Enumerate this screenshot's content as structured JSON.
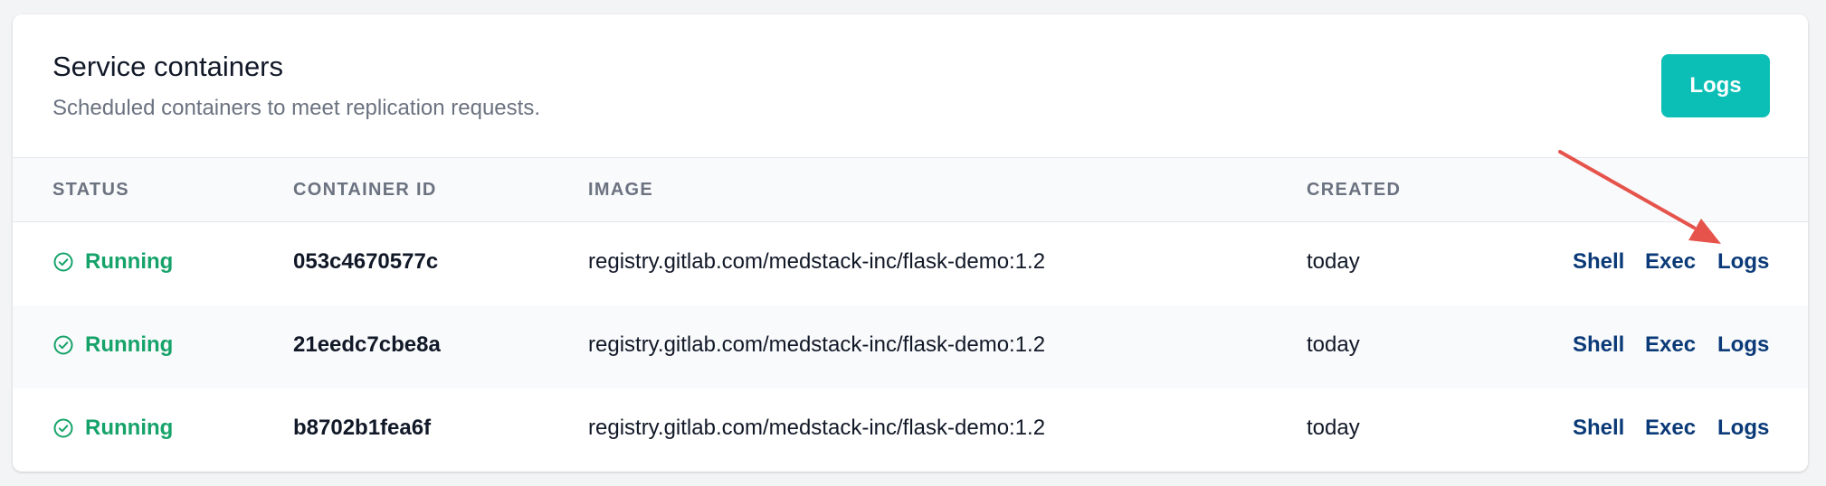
{
  "header": {
    "title": "Service containers",
    "subtitle": "Scheduled containers to meet replication requests.",
    "logs_button_label": "Logs"
  },
  "table": {
    "columns": {
      "status": "STATUS",
      "container_id": "CONTAINER ID",
      "image": "IMAGE",
      "created": "CREATED"
    },
    "rows": [
      {
        "status": "Running",
        "container_id": "053c4670577c",
        "image": "registry.gitlab.com/medstack-inc/flask-demo:1.2",
        "created": "today",
        "actions": {
          "shell": "Shell",
          "exec": "Exec",
          "logs": "Logs"
        }
      },
      {
        "status": "Running",
        "container_id": "21eedc7cbe8a",
        "image": "registry.gitlab.com/medstack-inc/flask-demo:1.2",
        "created": "today",
        "actions": {
          "shell": "Shell",
          "exec": "Exec",
          "logs": "Logs"
        }
      },
      {
        "status": "Running",
        "container_id": "b8702b1fea6f",
        "image": "registry.gitlab.com/medstack-inc/flask-demo:1.2",
        "created": "today",
        "actions": {
          "shell": "Shell",
          "exec": "Exec",
          "logs": "Logs"
        }
      }
    ]
  },
  "icons": {
    "status": "check-circle-icon",
    "annotation": "annotation-arrow"
  },
  "colors": {
    "accent_button": "#0bbfb6",
    "status_running": "#16a36a",
    "action_link": "#0b3a78",
    "annotation_arrow": "#e5534b"
  }
}
